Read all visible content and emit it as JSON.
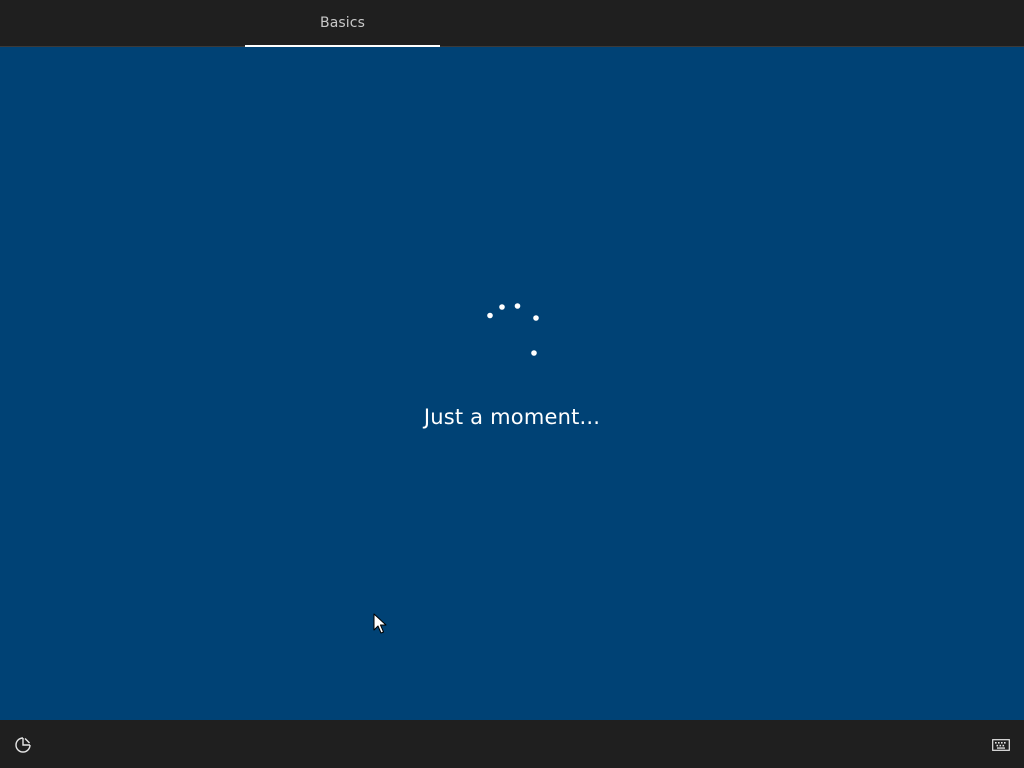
{
  "header": {
    "tabs": [
      {
        "label": "Basics",
        "active": true
      }
    ]
  },
  "main": {
    "status_text": "Just a moment...",
    "spinner_icon": "loading-dots-icon"
  },
  "footer": {
    "left_icon": "ease-of-access-icon",
    "right_icon": "keyboard-icon"
  },
  "colors": {
    "background": "#004275",
    "bar": "#1f1f1f",
    "text": "#ffffff",
    "tab_text": "#c8c8c8"
  }
}
